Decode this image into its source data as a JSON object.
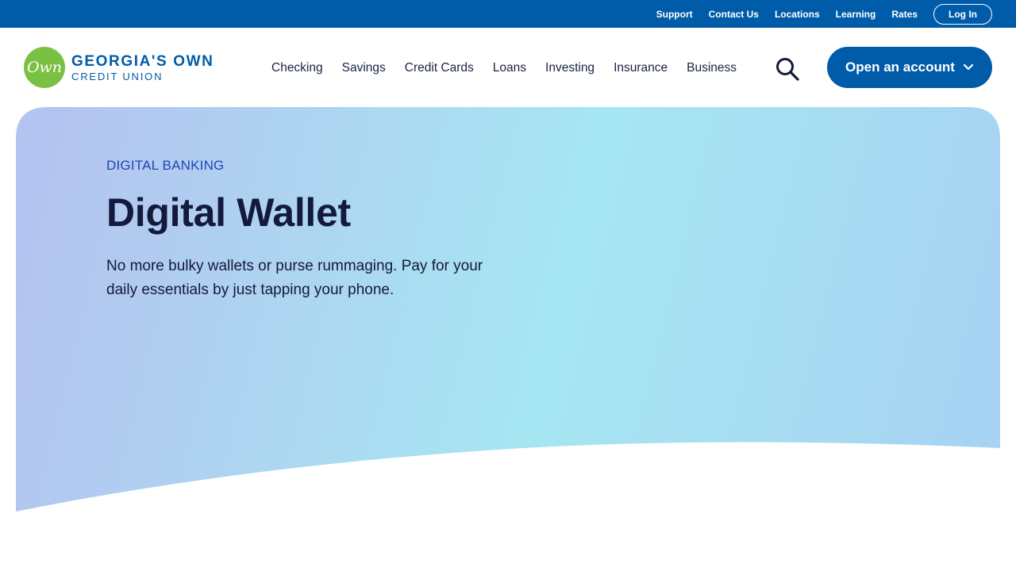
{
  "utility_bar": {
    "links": [
      "Support",
      "Contact Us",
      "Locations",
      "Learning",
      "Rates"
    ],
    "login_label": "Log In"
  },
  "logo": {
    "mark_text": "Own",
    "line1": "GEORGIA'S OWN",
    "line2": "CREDIT UNION"
  },
  "nav": {
    "items": [
      "Checking",
      "Savings",
      "Credit Cards",
      "Loans",
      "Investing",
      "Insurance",
      "Business"
    ],
    "open_account_label": "Open an account"
  },
  "hero": {
    "eyebrow": "DIGITAL BANKING",
    "title": "Digital Wallet",
    "description": "No more bulky wallets or purse rummaging. Pay for your daily essentials by just tapping your phone."
  },
  "colors": {
    "brand_blue": "#005ca8",
    "brand_green": "#7ac143",
    "heading_navy": "#141a3c",
    "eyebrow_blue": "#2145b5",
    "hero_gradient": [
      "#b4c4f0",
      "#a6e6f2",
      "#a7d3f2"
    ]
  },
  "icons": {
    "search": "search-icon",
    "chevron": "chevron-down-icon"
  }
}
